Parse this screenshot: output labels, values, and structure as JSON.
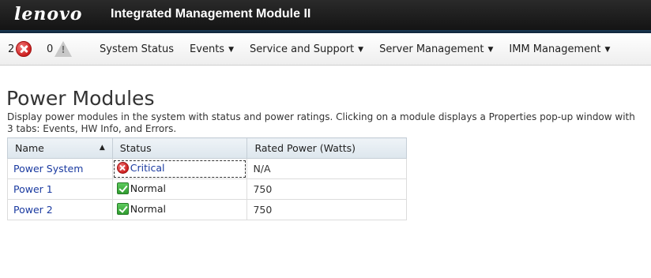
{
  "header": {
    "logo": "lenovo",
    "title": "Integrated Management Module II"
  },
  "alerts": {
    "error_count": "2",
    "warning_count": "0"
  },
  "nav": {
    "items": [
      {
        "label": "System Status",
        "has_menu": false
      },
      {
        "label": "Events",
        "has_menu": true
      },
      {
        "label": "Service and Support",
        "has_menu": true
      },
      {
        "label": "Server Management",
        "has_menu": true
      },
      {
        "label": "IMM Management",
        "has_menu": true
      }
    ]
  },
  "page": {
    "title": "Power Modules",
    "description": "Display power modules in the system with status and power ratings. Clicking on a module displays a Properties pop-up window with 3 tabs: Events, HW Info, and Errors."
  },
  "table": {
    "columns": [
      "Name",
      "Status",
      "Rated Power (Watts)"
    ],
    "rows": [
      {
        "name": "Power System",
        "status": "Critical",
        "status_icon": "critical-icon",
        "rated_power": "N/A"
      },
      {
        "name": "Power 1",
        "status": "Normal",
        "status_icon": "check-icon",
        "rated_power": "750"
      },
      {
        "name": "Power 2",
        "status": "Normal",
        "status_icon": "check-icon",
        "rated_power": "750"
      }
    ]
  },
  "colors": {
    "banner": "#1c1c1c",
    "link": "#1a3aa0",
    "critical": "#cc1f1f",
    "normal": "#2f9c2f"
  }
}
